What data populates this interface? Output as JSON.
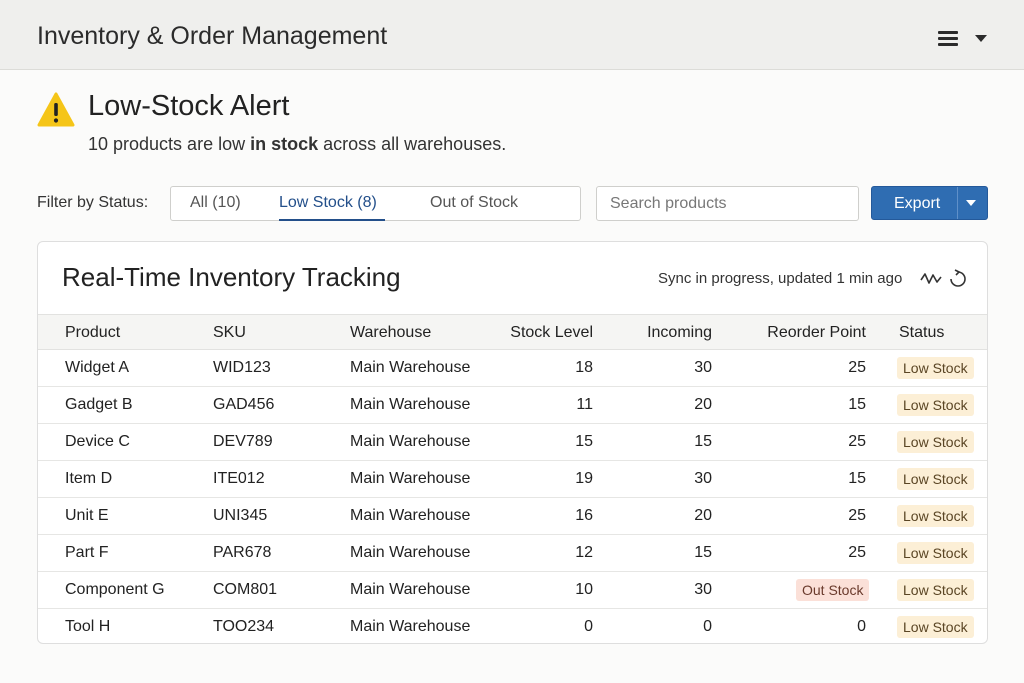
{
  "app": {
    "title": "Inventory & Order Management"
  },
  "alert": {
    "title": "Low-Stock Alert",
    "message_pre": "10 products are low ",
    "message_bold": "in stock",
    "message_post": " across all warehouses."
  },
  "filter": {
    "label": "Filter by Status:",
    "tabs": [
      {
        "label": "All (10)",
        "active": false
      },
      {
        "label": "Low Stock (8)",
        "active": true
      },
      {
        "label": "Out of Stock",
        "active": false
      }
    ]
  },
  "search": {
    "placeholder": "Search products"
  },
  "export": {
    "label": "Export"
  },
  "card": {
    "title": "Real-Time Inventory Tracking",
    "sync_text": "Sync in progress, updated 1 min ago"
  },
  "table": {
    "columns": [
      "Product",
      "SKU",
      "Warehouse",
      "Stock Level",
      "Incoming",
      "Reorder Point",
      "Status"
    ],
    "rows": [
      {
        "product": "Widget A",
        "sku": "WID123",
        "warehouse": "Main Warehouse",
        "stock": "18",
        "incoming": "30",
        "reorder": "25",
        "reorder_badge": "",
        "status": "Low Stock"
      },
      {
        "product": "Gadget B",
        "sku": "GAD456",
        "warehouse": "Main Warehouse",
        "stock": "11",
        "incoming": "20",
        "reorder": "15",
        "reorder_badge": "",
        "status": "Low Stock"
      },
      {
        "product": "Device C",
        "sku": "DEV789",
        "warehouse": "Main Warehouse",
        "stock": "15",
        "incoming": "15",
        "reorder": "25",
        "reorder_badge": "",
        "status": "Low Stock"
      },
      {
        "product": "Item D",
        "sku": "ITE012",
        "warehouse": "Main Warehouse",
        "stock": "19",
        "incoming": "30",
        "reorder": "15",
        "reorder_badge": "",
        "status": "Low Stock"
      },
      {
        "product": "Unit E",
        "sku": "UNI345",
        "warehouse": "Main Warehouse",
        "stock": "16",
        "incoming": "20",
        "reorder": "25",
        "reorder_badge": "",
        "status": "Low Stock"
      },
      {
        "product": "Part F",
        "sku": "PAR678",
        "warehouse": "Main Warehouse",
        "stock": "12",
        "incoming": "15",
        "reorder": "25",
        "reorder_badge": "",
        "status": "Low Stock"
      },
      {
        "product": "Component G",
        "sku": "COM801",
        "warehouse": "Main Warehouse",
        "stock": "10",
        "incoming": "30",
        "reorder": "",
        "reorder_badge": "Out Stock",
        "status": "Low Stock"
      },
      {
        "product": "Tool H",
        "sku": "TOO234",
        "warehouse": "Main Warehouse",
        "stock": "0",
        "incoming": "0",
        "reorder": "0",
        "reorder_badge": "",
        "status": "Low Stock"
      }
    ]
  },
  "icons": {
    "alert": "warning-triangle-icon",
    "menu": "hamburger-menu-icon",
    "menu_caret": "chevron-down-icon",
    "export_caret": "chevron-down-icon",
    "sync": "sync-activity-icon"
  },
  "colors": {
    "primary": "#2f6db2",
    "warning": "#f5c518",
    "low_badge_bg": "#fcefd6",
    "out_badge_bg": "#fbe0d8",
    "active_tab": "#234f8a"
  }
}
